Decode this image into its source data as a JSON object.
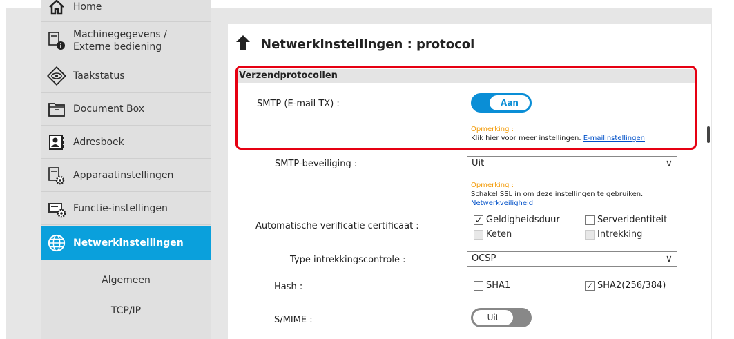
{
  "sidebar": {
    "items": [
      {
        "label": "Home",
        "icon": "home-icon"
      },
      {
        "label_line1": "Machinegegevens /",
        "label_line2": "Externe bediening",
        "icon": "machine-info-icon"
      },
      {
        "label": "Taakstatus",
        "icon": "eye-icon"
      },
      {
        "label": "Document Box",
        "icon": "document-box-icon"
      },
      {
        "label": "Adresboek",
        "icon": "address-book-icon"
      },
      {
        "label": "Apparaatinstellingen",
        "icon": "device-settings-icon"
      },
      {
        "label": "Functie-instellingen",
        "icon": "function-settings-icon"
      },
      {
        "label": "Netwerkinstellingen",
        "icon": "globe-icon",
        "active": true
      },
      {
        "label": "Algemeen"
      },
      {
        "label": "TCP/IP"
      }
    ]
  },
  "main": {
    "title": "Netwerkinstellingen : protocol",
    "section": "Verzendprotocollen",
    "smtp": {
      "label": "SMTP (E-mail TX) :",
      "toggle": "Aan"
    },
    "note1": {
      "warn": "Opmerking :",
      "text": "Klik hier voor meer instellingen. ",
      "link": "E-mailinstellingen"
    },
    "smtp_sec": {
      "label": "SMTP-beveiliging :",
      "value": "Uit"
    },
    "note2": {
      "warn": "Opmerking :",
      "text": "Schakel SSL in om deze instellingen te gebruiken.",
      "link": "Netwerkveiligheid"
    },
    "autoverify": {
      "label": "Automatische verificatie certificaat :",
      "options": [
        {
          "label": "Geldigheidsduur",
          "checked": true,
          "enabled": true
        },
        {
          "label": "Serveridentiteit",
          "checked": false,
          "enabled": true
        },
        {
          "label": "Keten",
          "checked": false,
          "enabled": false
        },
        {
          "label": "Intrekking",
          "checked": false,
          "enabled": false
        }
      ]
    },
    "revocation": {
      "label": "Type intrekkingscontrole :",
      "value": "OCSP"
    },
    "hash": {
      "label": "Hash :",
      "sha1": "SHA1",
      "sha1_checked": false,
      "sha2": "SHA2(256/384)",
      "sha2_checked": true
    },
    "smime": {
      "label": "S/MIME :",
      "toggle": "Uit"
    }
  },
  "colors": {
    "accent": "#0aa0dc",
    "highlight": "#e60012",
    "warn": "#f39800",
    "link": "#0050c8"
  }
}
